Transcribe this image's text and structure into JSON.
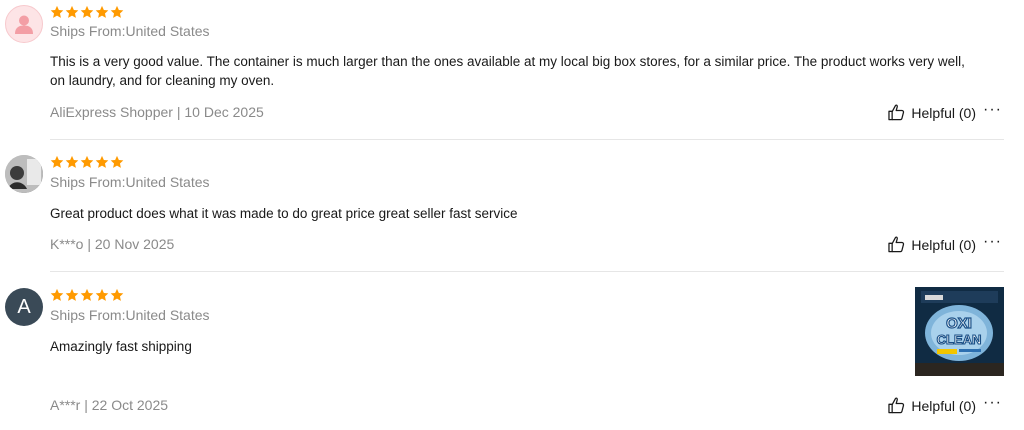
{
  "reviews": [
    {
      "rating": 5,
      "ships_from": "Ships From:United States",
      "text": "This is a very good value. The container is much larger than the ones available at my local big box stores, for a similar price. The product works very well, on laundry, and for cleaning my oven.",
      "meta": "AliExpress Shopper | 10 Dec 2025",
      "helpful_label": "Helpful (0)",
      "more_label": "···"
    },
    {
      "rating": 5,
      "ships_from": "Ships From:United States",
      "text": "Great product does what it was made to do great price great seller fast service",
      "meta": "K***o | 20 Nov 2025",
      "helpful_label": "Helpful (0)",
      "more_label": "···"
    },
    {
      "avatar_letter": "A",
      "rating": 5,
      "ships_from": "Ships From:United States",
      "text": "Amazingly fast shipping",
      "meta": "A***r | 22 Oct 2025",
      "helpful_label": "Helpful (0)",
      "more_label": "···",
      "photo_text": {
        "brand_top": "OXI",
        "brand_bottom": "CLEAN"
      }
    }
  ],
  "colors": {
    "star": "#ff9a00",
    "text": "#191919",
    "muted": "#8a8a8a",
    "divider": "#e6e6e6"
  },
  "icons": {
    "star": "star-icon",
    "helpful": "thumbs-up-icon",
    "more": "more-options-icon",
    "default_avatar": "user-silhouette-icon"
  }
}
